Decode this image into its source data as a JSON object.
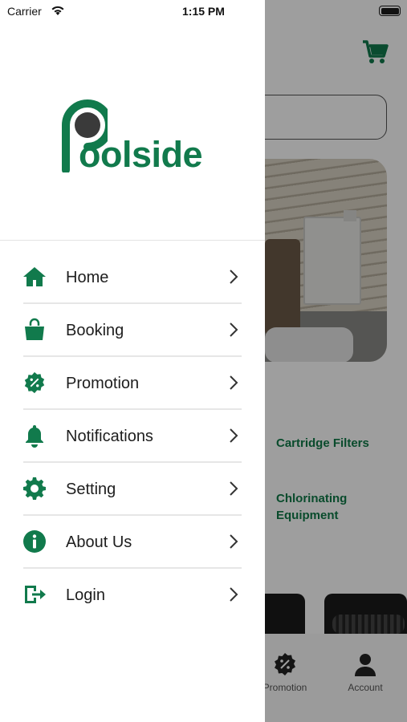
{
  "status_bar": {
    "carrier": "Carrier",
    "time": "1:15 PM"
  },
  "drawer": {
    "logo_text": "oolside",
    "menu": [
      {
        "label": "Home",
        "icon": "home-icon"
      },
      {
        "label": "Booking",
        "icon": "shopping-bag-icon"
      },
      {
        "label": "Promotion",
        "icon": "promotion-badge-icon"
      },
      {
        "label": "Notifications",
        "icon": "bell-icon"
      },
      {
        "label": "Setting",
        "icon": "gear-icon"
      },
      {
        "label": "About Us",
        "icon": "info-icon"
      },
      {
        "label": "Login",
        "icon": "login-icon"
      }
    ]
  },
  "background": {
    "categories": [
      "Cartridge Filters",
      "Chlorinating Equipment"
    ],
    "tabs": [
      {
        "label": "Promotion",
        "icon": "promotion-badge-icon"
      },
      {
        "label": "Account",
        "icon": "user-icon"
      }
    ]
  },
  "colors": {
    "brand_green": "#117a4c",
    "overlay": "rgba(0,0,0,0.38)"
  }
}
